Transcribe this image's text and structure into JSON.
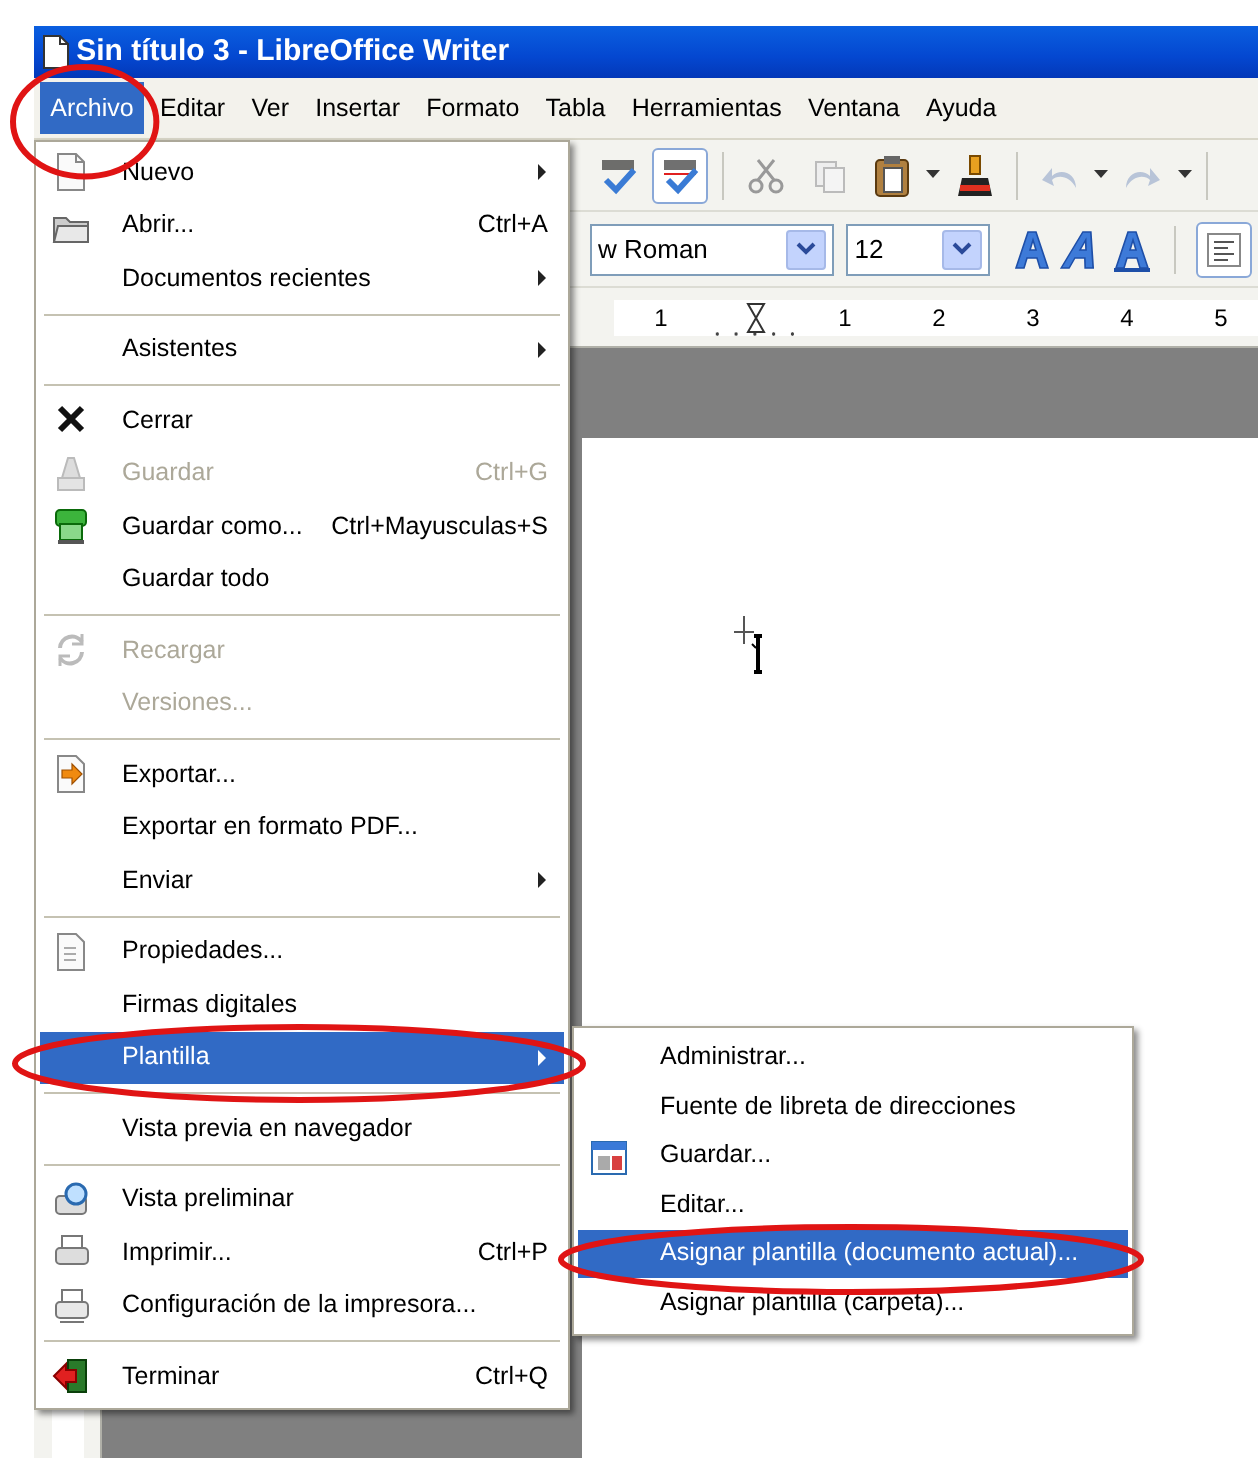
{
  "window": {
    "title": "Sin título 3 - LibreOffice Writer"
  },
  "menubar": [
    {
      "label": "Archivo",
      "selected": true,
      "circled": true
    },
    {
      "label": "Editar",
      "selected": false,
      "circled": false
    },
    {
      "label": "Ver",
      "selected": false,
      "circled": false
    },
    {
      "label": "Insertar",
      "selected": false,
      "circled": false
    },
    {
      "label": "Formato",
      "selected": false,
      "circled": false
    },
    {
      "label": "Tabla",
      "selected": false,
      "circled": false
    },
    {
      "label": "Herramientas",
      "selected": false,
      "circled": false
    },
    {
      "label": "Ventana",
      "selected": false,
      "circled": false
    },
    {
      "label": "Ayuda",
      "selected": false,
      "circled": false
    }
  ],
  "formatting_toolbar": {
    "font_name": "w Roman",
    "font_size": "12"
  },
  "ruler": {
    "labels": [
      "1",
      "1",
      "2",
      "3",
      "4",
      "5"
    ]
  },
  "file_menu": [
    {
      "kind": "item",
      "label": "Nuevo",
      "disabled": false,
      "has_submenu": true,
      "selected": false,
      "circled": false
    },
    {
      "kind": "item",
      "label": "Abrir...",
      "shortcut": "Ctrl+A",
      "disabled": false,
      "has_submenu": false,
      "selected": false,
      "circled": false
    },
    {
      "kind": "item",
      "label": "Documentos recientes",
      "disabled": false,
      "has_submenu": true,
      "selected": false,
      "circled": false
    },
    {
      "kind": "separator"
    },
    {
      "kind": "item",
      "label": "Asistentes",
      "disabled": false,
      "has_submenu": true,
      "selected": false,
      "circled": false
    },
    {
      "kind": "separator"
    },
    {
      "kind": "item",
      "label": "Cerrar",
      "disabled": false,
      "has_submenu": false,
      "selected": false,
      "circled": false
    },
    {
      "kind": "item",
      "label": "Guardar",
      "shortcut": "Ctrl+G",
      "disabled": true,
      "has_submenu": false,
      "selected": false,
      "circled": false
    },
    {
      "kind": "item",
      "label": "Guardar como...",
      "shortcut": "Ctrl+Mayusculas+S",
      "disabled": false,
      "has_submenu": false,
      "selected": false,
      "circled": false
    },
    {
      "kind": "item",
      "label": "Guardar todo",
      "disabled": false,
      "has_submenu": false,
      "selected": false,
      "circled": false
    },
    {
      "kind": "separator"
    },
    {
      "kind": "item",
      "label": "Recargar",
      "disabled": true,
      "has_submenu": false,
      "selected": false,
      "circled": false
    },
    {
      "kind": "item",
      "label": "Versiones...",
      "disabled": true,
      "has_submenu": false,
      "selected": false,
      "circled": false
    },
    {
      "kind": "separator"
    },
    {
      "kind": "item",
      "label": "Exportar...",
      "disabled": false,
      "has_submenu": false,
      "selected": false,
      "circled": false
    },
    {
      "kind": "item",
      "label": "Exportar en formato PDF...",
      "disabled": false,
      "has_submenu": false,
      "selected": false,
      "circled": false
    },
    {
      "kind": "item",
      "label": "Enviar",
      "disabled": false,
      "has_submenu": true,
      "selected": false,
      "circled": false
    },
    {
      "kind": "separator"
    },
    {
      "kind": "item",
      "label": "Propiedades...",
      "disabled": false,
      "has_submenu": false,
      "selected": false,
      "circled": false
    },
    {
      "kind": "item",
      "label": "Firmas digitales",
      "disabled": false,
      "has_submenu": false,
      "selected": false,
      "circled": false
    },
    {
      "kind": "item",
      "label": "Plantilla",
      "disabled": false,
      "has_submenu": true,
      "selected": true,
      "circled": true
    },
    {
      "kind": "separator"
    },
    {
      "kind": "item",
      "label": "Vista previa en navegador",
      "disabled": false,
      "has_submenu": false,
      "selected": false,
      "circled": false
    },
    {
      "kind": "separator"
    },
    {
      "kind": "item",
      "label": "Vista preliminar",
      "disabled": false,
      "has_submenu": false,
      "selected": false,
      "circled": false
    },
    {
      "kind": "item",
      "label": "Imprimir...",
      "shortcut": "Ctrl+P",
      "disabled": false,
      "has_submenu": false,
      "selected": false,
      "circled": false
    },
    {
      "kind": "item",
      "label": "Configuración de la impresora...",
      "disabled": false,
      "has_submenu": false,
      "selected": false,
      "circled": false
    },
    {
      "kind": "separator"
    },
    {
      "kind": "item",
      "label": "Terminar",
      "shortcut": "Ctrl+Q",
      "disabled": false,
      "has_submenu": false,
      "selected": false,
      "circled": false
    }
  ],
  "template_submenu": [
    {
      "kind": "item",
      "label": "Administrar...",
      "disabled": false,
      "has_submenu": false,
      "selected": false,
      "circled": false
    },
    {
      "kind": "item",
      "label": "Fuente de libreta de direcciones",
      "disabled": false,
      "has_submenu": false,
      "selected": false,
      "circled": false
    },
    {
      "kind": "item",
      "label": "Guardar...",
      "disabled": false,
      "has_submenu": false,
      "selected": false,
      "circled": false
    },
    {
      "kind": "item",
      "label": "Editar...",
      "disabled": false,
      "has_submenu": false,
      "selected": false,
      "circled": false
    },
    {
      "kind": "item",
      "label": "Asignar plantilla (documento actual)...",
      "disabled": false,
      "has_submenu": false,
      "selected": true,
      "circled": true
    },
    {
      "kind": "item",
      "label": "Asignar plantilla (carpeta)...",
      "disabled": false,
      "has_submenu": false,
      "selected": false,
      "circled": false
    }
  ]
}
